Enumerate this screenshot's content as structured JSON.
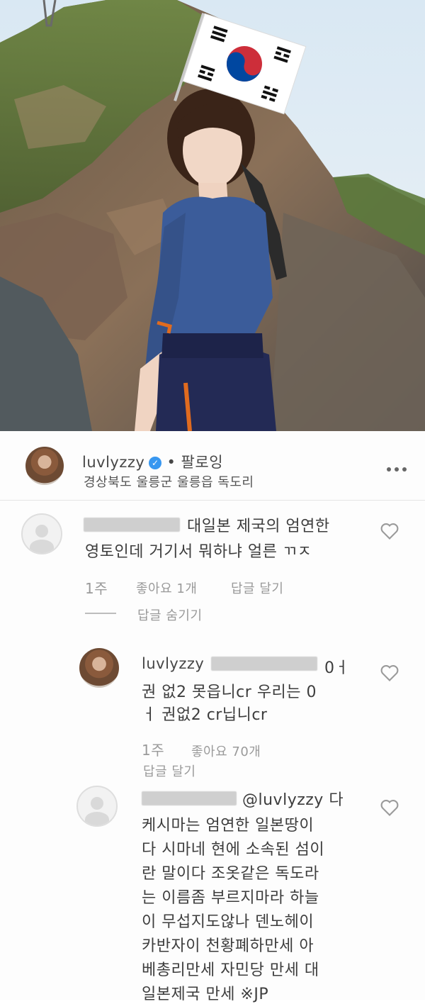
{
  "post": {
    "username": "luvlyzzy",
    "follow_label": "• 팔로잉",
    "location": "경상북도 울릉군 울릉읍 독도리"
  },
  "comments": [
    {
      "lines": [
        "대일본 제국의 엄연한",
        "영토인데 거기서 뭐하냐 얼른 ㄲㅈ"
      ],
      "time": "1주",
      "likes": "좋아요 1개",
      "reply_label": "답글 달기",
      "hide_replies": "답글 숨기기"
    },
    {
      "username": "luvlyzzy",
      "mention_tail": "0ㅓ",
      "lines": [
        "권 없2 못읍니cr 우리는 0",
        "ㅓ 권없2 cr닙니cr"
      ],
      "time": "1주",
      "likes": "좋아요 70개",
      "reply_label": "답글 달기"
    },
    {
      "mention": "@luvlyzzy 다",
      "lines": [
        "케시마는 엄연한 일본땅이",
        "다 시마네 현에 소속된 섬이",
        "란 말이다 조옷같은 독도라",
        "는 이름좀 부르지마라 하늘",
        "이 무섭지도않나 덴노헤이",
        "카반자이 천황폐하만세 아",
        "베총리만세 자민당 만세 대",
        "일본제국 만세 ※JP"
      ]
    }
  ],
  "icons": [
    "verified-badge-icon",
    "more-options-icon",
    "heart-icon",
    "default-avatar-icon"
  ],
  "colors": {
    "verified": "#3897f0",
    "flag_red": "#cd2e3a",
    "flag_blue": "#0047a0"
  }
}
